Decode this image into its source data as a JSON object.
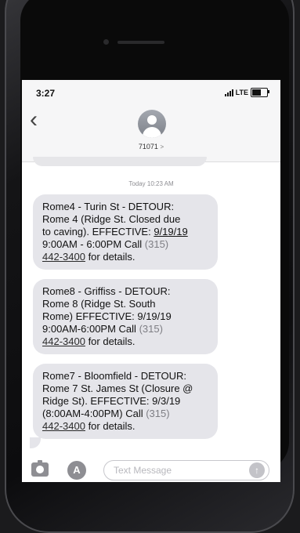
{
  "status_bar": {
    "time": "3:27",
    "network": "LTE"
  },
  "header": {
    "back_icon": "chevron-left-icon",
    "contact_name": "71071",
    "contact_chevron": ">"
  },
  "conversation": {
    "timestamp": "Today 10:23 AM",
    "messages": [
      {
        "lines": [
          "Rome4 - Turin St - DETOUR:",
          "Rome 4 (Ridge St. Closed due",
          "to caving). EFFECTIVE: "
        ],
        "effective_date": "9/19/19",
        "time_line": "9:00AM - 6:00PM Call ",
        "phone_area": "(315)",
        "phone_number": "442-3400",
        "suffix": " for details."
      },
      {
        "lines": [
          "Rome8 - Griffiss - DETOUR:",
          "Rome 8 (Ridge St. South",
          "Rome) EFFECTIVE: 9/19/19",
          "9:00AM-6:00PM Call "
        ],
        "phone_area": "(315)",
        "phone_number": "442-3400",
        "suffix": " for details."
      },
      {
        "lines": [
          "Rome7 - Bloomfield - DETOUR:",
          "Rome 7 St. James St (Closure @",
          "Ridge St). EFFECTIVE: 9/3/19",
          "(8:00AM-4:00PM) Call "
        ],
        "phone_area": "(315)",
        "phone_number": "442-3400",
        "suffix": " for details."
      }
    ]
  },
  "input_bar": {
    "placeholder": "Text Message",
    "camera_icon": "camera-icon",
    "apps_icon": "app-store-icon",
    "apps_glyph": "A",
    "send_icon": "send-arrow-icon",
    "send_glyph": "↑"
  }
}
